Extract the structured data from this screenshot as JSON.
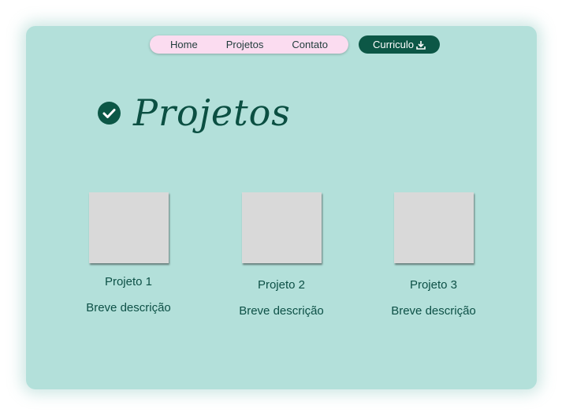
{
  "nav": {
    "items": [
      {
        "label": "Home"
      },
      {
        "label": "Projetos"
      },
      {
        "label": "Contato"
      }
    ],
    "cv_button": {
      "label": "Curriculo",
      "icon": "download-icon"
    }
  },
  "section": {
    "title": "Projetos",
    "icon": "check-circle-icon"
  },
  "projects": [
    {
      "name": "Projeto 1",
      "description": "Breve descrição"
    },
    {
      "name": "Projeto 2",
      "description": "Breve descrição"
    },
    {
      "name": "Projeto 3",
      "description": "Breve descrição"
    }
  ],
  "colors": {
    "card_bg": "#b3e0da",
    "nav_bg": "#fbdcf0",
    "accent": "#0c5746",
    "thumb": "#d9d9d9"
  }
}
